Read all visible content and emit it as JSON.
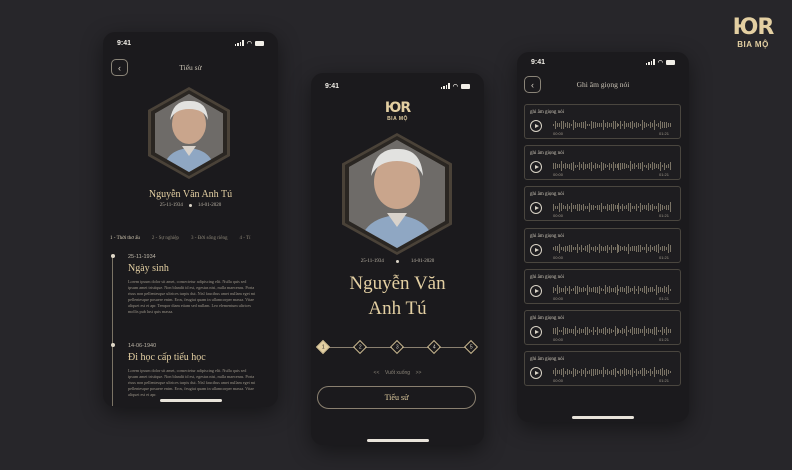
{
  "brand": {
    "logo_mark": "ЮR",
    "logo_text": "BIA MỘ",
    "accent": "#e3cfa2"
  },
  "status_bar": {
    "time": "9:41"
  },
  "person": {
    "name": "Nguyễn Văn Anh Tú",
    "name_card": "Nguyễn Văn Anh Tú",
    "name_line1": "Nguyễn Văn",
    "name_line2": "Anh Tú",
    "birth": "25-11-1934",
    "death": "14-01-2020"
  },
  "bio_screen": {
    "title": "Tiểu sử",
    "tabs": [
      "1 - Thời thơ ấu",
      "2 - Sự nghiệp",
      "3 - Đời sống riêng",
      "4 - Tí"
    ],
    "events": [
      {
        "date": "25-11-1934",
        "title": "Ngày sinh",
        "body": "Lorem ipsum dolor sit amet, consectetur adipiscing elit. Nulla quis sed ipsum amet tristique. Non blandit id est, egestas nisi, nulla maecenas. Porta risus non pellentesque ultrices turpis dui. Nisl faucibus amet nullam eget mi pellentesque posuere enim. Eros, feugiat quam in ullamcorper massa. Vitae aliquet est et apr. Tempor diam etiam sed nullam. Leo elementum ultrices mollis pub lust quis massa."
      },
      {
        "date": "14-06-1940",
        "title": "Đi học cấp tiểu học",
        "body": "Lorem ipsum dolor sit amet, consectetur adipiscing elit. Nulla quis sed ipsum amet tristique. Non blandit id est, egestas nisi, nulla maecenas. Porta risus non pellentesque ultrices turpis dui. Nisl faucibus amet nullam eget mi pellentesque posuere enim. Eros, feugiat quam in ullamcorper massa. Vitae aliquet est et apr."
      }
    ]
  },
  "profile_screen": {
    "steps": [
      "1",
      "2",
      "3",
      "4",
      "5"
    ],
    "swipe_hint": "Vuốt xuống",
    "swipe_left": "<<",
    "swipe_right": ">>",
    "bio_button": "Tiểu sử"
  },
  "voice_screen": {
    "title": "Ghi âm giọng nói",
    "recordings": [
      {
        "title": "ghi âm giọng nói",
        "start": "00:00",
        "end": "01:21"
      },
      {
        "title": "ghi âm giọng nói",
        "start": "00:00",
        "end": "01:21"
      },
      {
        "title": "ghi âm giọng nói",
        "start": "00:00",
        "end": "01:21"
      },
      {
        "title": "ghi âm giọng nói",
        "start": "00:00",
        "end": "01:21"
      },
      {
        "title": "ghi âm giọng nói",
        "start": "00:00",
        "end": "01:21"
      },
      {
        "title": "ghi âm giọng nói",
        "start": "00:00",
        "end": "01:21"
      },
      {
        "title": "ghi âm giọng nói",
        "start": "00:00",
        "end": "01:21"
      }
    ]
  }
}
